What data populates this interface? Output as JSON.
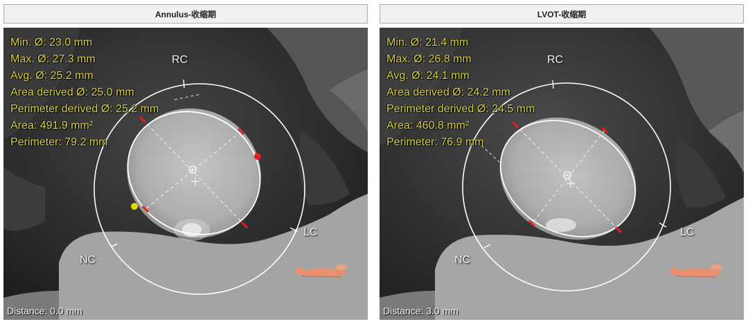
{
  "left": {
    "title": "Annulus-收缩期",
    "measurements": {
      "min": "Min. Ø: 23.0 mm",
      "max": "Max. Ø: 27.3 mm",
      "avg": "Avg. Ø: 25.2 mm",
      "area_derived": "Area derived Ø: 25.0 mm",
      "perimeter_derived": "Perimeter derived Ø: 25.2 mm",
      "area": "Area: 491.9 mm²",
      "perimeter": "Perimeter: 79.2 mm"
    },
    "labels": {
      "rc": "RC",
      "lc": "LC",
      "nc": "NC"
    },
    "distance": "Distance: 0.0 mm"
  },
  "right": {
    "title": "LVOT-收缩期",
    "measurements": {
      "min": "Min. Ø: 21.4 mm",
      "max": "Max. Ø: 26.8 mm",
      "avg": "Avg. Ø: 24.1 mm",
      "area_derived": "Area derived Ø: 24.2 mm",
      "perimeter_derived": "Perimeter derived Ø: 24.5 mm",
      "area": "Area: 460.8 mm²",
      "perimeter": "Perimeter: 76.9 mm"
    },
    "labels": {
      "rc": "RC",
      "lc": "LC",
      "nc": "NC"
    },
    "distance": "Distance: 3.0 mm"
  },
  "colors": {
    "measurement_text": "#dcd24a",
    "overlay_line": "#ffffff",
    "marker_red": "#e02020",
    "marker_yellow": "#e0d800",
    "body_icon": "#e89070"
  }
}
